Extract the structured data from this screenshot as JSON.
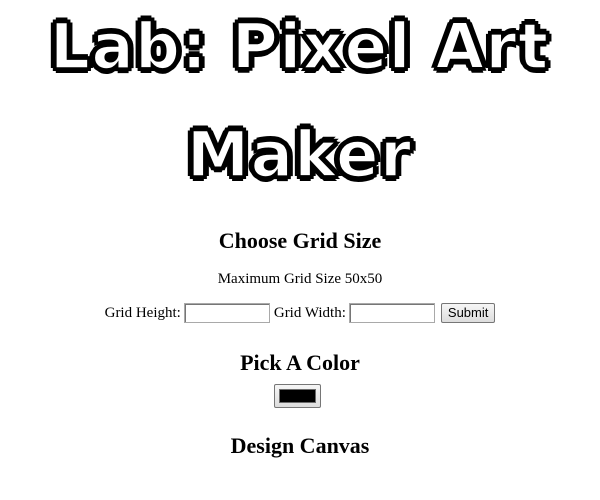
{
  "title": {
    "line1": "Lab: Pixel Art",
    "line2": "Maker"
  },
  "grid_section": {
    "heading": "Choose Grid Size",
    "note": "Maximum Grid Size 50x50",
    "height_label": "Grid Height:",
    "height_value": "",
    "width_label": "Grid Width:",
    "width_value": "",
    "submit_label": "Submit"
  },
  "color_section": {
    "heading": "Pick A Color",
    "selected_color": "#000000"
  },
  "canvas_section": {
    "heading": "Design Canvas"
  }
}
